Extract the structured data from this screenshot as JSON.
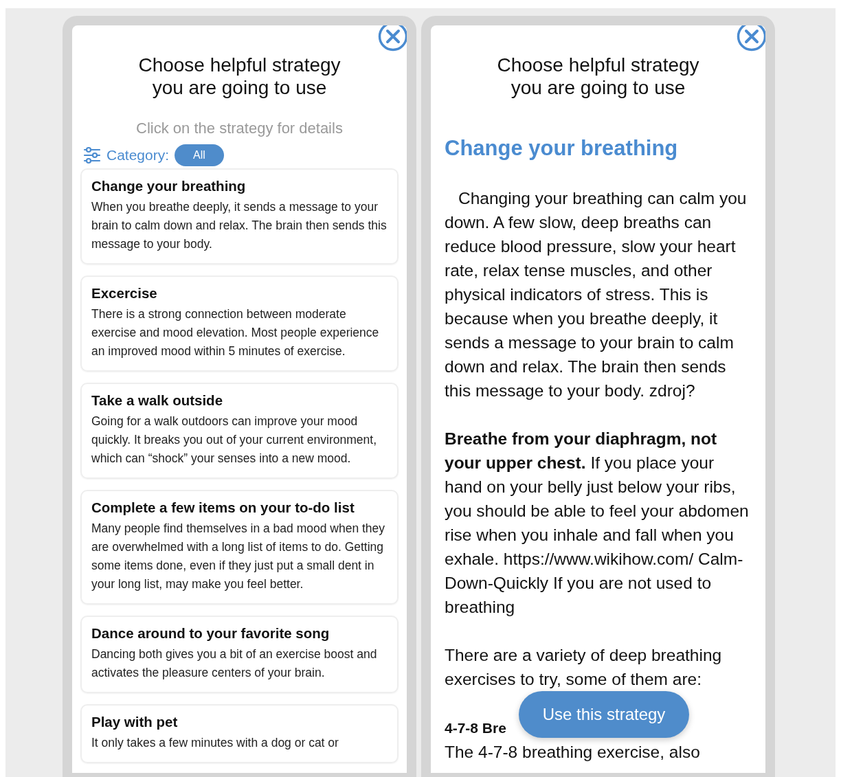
{
  "panels": [
    {
      "kind": "list",
      "title_lines": [
        "Choose helpful strategy",
        "you are going to use"
      ],
      "hint": "Click on the strategy for details",
      "category_label": "Category:",
      "category_value": "All",
      "strategies": [
        {
          "title": "Change your breathing",
          "description": "When you breathe deeply, it sends a message to your brain to calm down and relax. The brain then sends this message to your body."
        },
        {
          "title": "Excercise",
          "description": "There is a strong connection between moderate exercise and mood elevation. Most people experience an improved mood within 5 minutes of exercise."
        },
        {
          "title": "Take a walk outside",
          "description": "Going for a walk outdoors can improve your mood quickly. It breaks you out of your current environment, which can “shock” your senses into a new mood."
        },
        {
          "title": "Complete a few items on your to-do list",
          "description": "Many people find themselves in a bad mood when they are overwhelmed with a long list of items to do. Getting some items done, even if they just put a small dent in your long list, may make you feel better."
        },
        {
          "title": "Dance around to your favorite song",
          "description": "Dancing both gives you a bit of an exercise boost and activates the pleasure centers of your brain."
        },
        {
          "title": "Play with pet",
          "description": "It only takes a few minutes with a dog or cat or"
        }
      ]
    },
    {
      "kind": "detail",
      "title_lines": [
        "Choose helpful strategy",
        "you are going to use"
      ],
      "heading": "Change your breathing",
      "paragraphs": [
        "Changing your breathing can calm you down. A few slow, deep breaths can reduce blood pressure, slow your heart rate, relax tense muscles, and other physical indicators of stress. This is because when you breathe deeply, it sends a message to your brain to calm down and relax. The brain then sends this message to your body. zdroj?",
        "**Breathe from your diaphragm, not your upper chest.** If you place your hand on your belly just below your ribs, you should be able to feel your abdomen rise when you inhale and fall when you exhale. https://www.wikihow.com/ Calm-Down-Quickly If you are not used to breathing",
        "There are a variety of deep breathing exercises to try, some of them are:"
      ],
      "subheading": "4-7-8 Bre",
      "subtext": "The 4-7-8 breathing exercise, also",
      "button": "Use this strategy"
    }
  ]
}
